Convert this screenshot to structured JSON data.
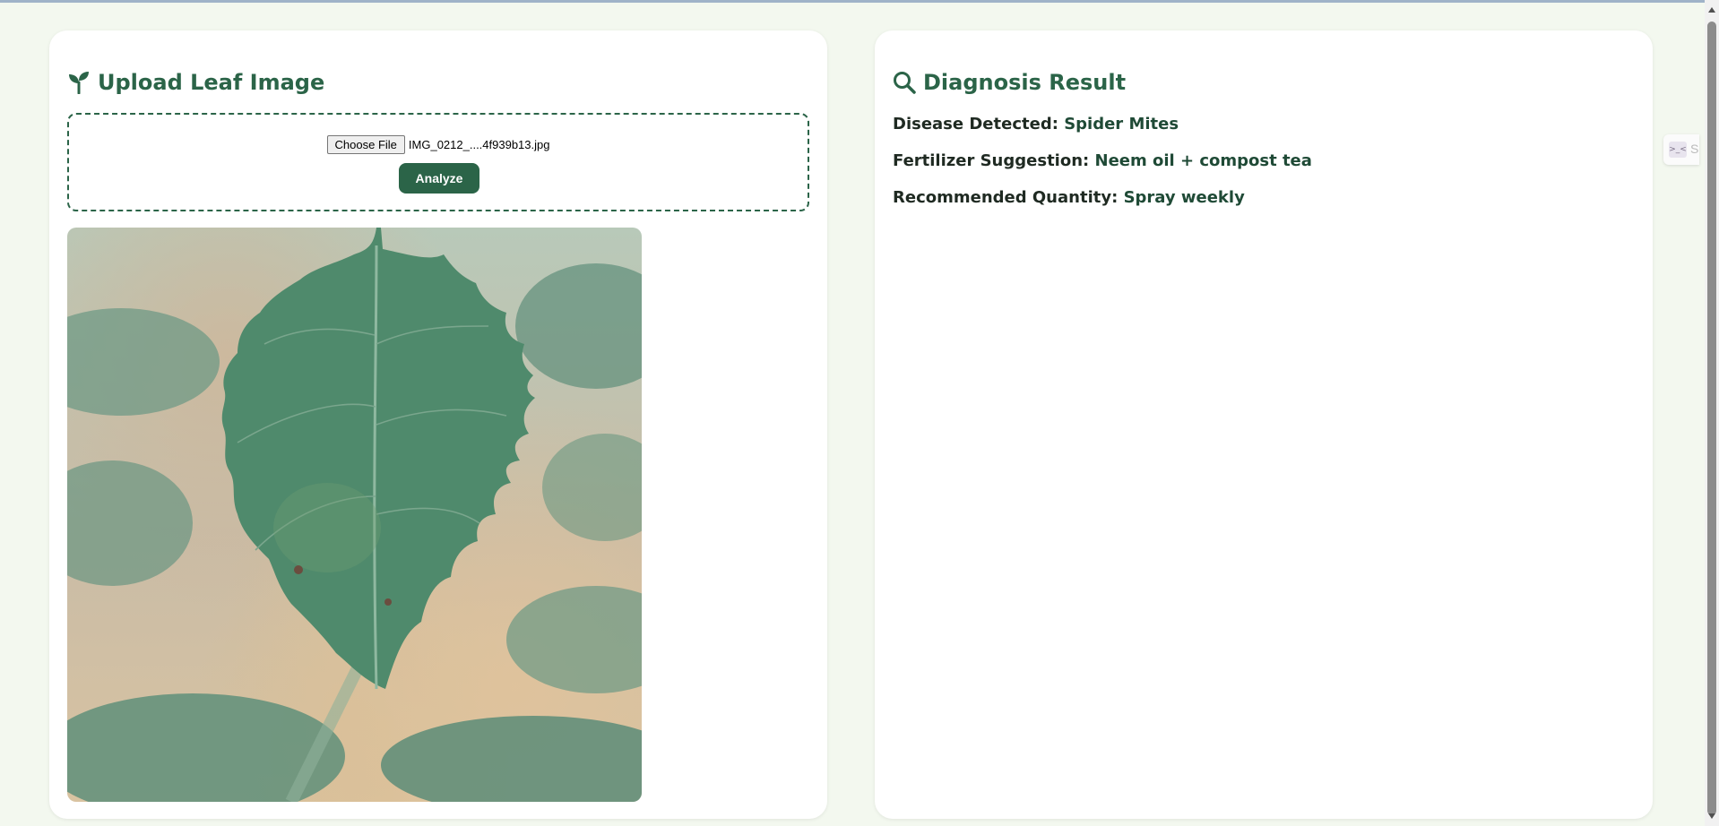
{
  "upload_panel": {
    "title": "Upload Leaf Image",
    "icon": "seedling-icon",
    "choose_file_label": "Choose File",
    "file_name": "IMG_0212_....4f939b13.jpg",
    "analyze_label": "Analyze",
    "preview_alt": "leaf-preview-image"
  },
  "result_panel": {
    "title": "Diagnosis Result",
    "icon": "search-icon",
    "disease_label": "Disease Detected:",
    "disease_value": "Spider Mites",
    "fertilizer_label": "Fertilizer Suggestion:",
    "fertilizer_value": "Neem oil + compost tea",
    "quantity_label": "Recommended Quantity:",
    "quantity_value": "Spray weekly"
  },
  "side_widget": {
    "label": "S"
  },
  "colors": {
    "accent": "#2b6448",
    "page_background": "#f3f8ef",
    "card_background": "#ffffff"
  }
}
